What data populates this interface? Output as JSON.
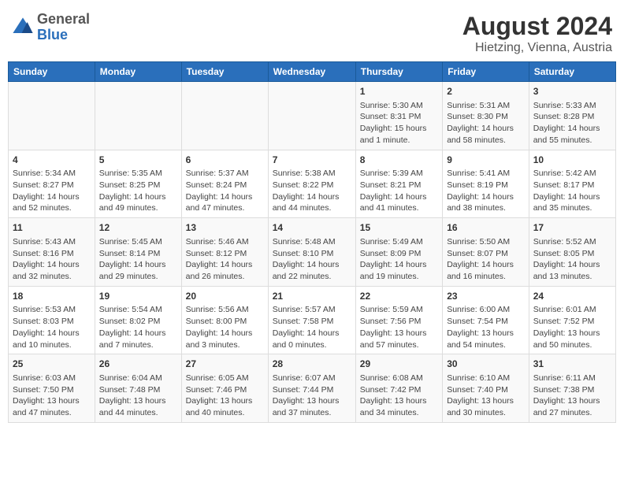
{
  "header": {
    "logo": {
      "general": "General",
      "blue": "Blue"
    },
    "title": "August 2024",
    "subtitle": "Hietzing, Vienna, Austria"
  },
  "weekdays": [
    "Sunday",
    "Monday",
    "Tuesday",
    "Wednesday",
    "Thursday",
    "Friday",
    "Saturday"
  ],
  "weeks": [
    [
      {
        "day": "",
        "info": ""
      },
      {
        "day": "",
        "info": ""
      },
      {
        "day": "",
        "info": ""
      },
      {
        "day": "",
        "info": ""
      },
      {
        "day": "1",
        "info": "Sunrise: 5:30 AM\nSunset: 8:31 PM\nDaylight: 15 hours and 1 minute."
      },
      {
        "day": "2",
        "info": "Sunrise: 5:31 AM\nSunset: 8:30 PM\nDaylight: 14 hours and 58 minutes."
      },
      {
        "day": "3",
        "info": "Sunrise: 5:33 AM\nSunset: 8:28 PM\nDaylight: 14 hours and 55 minutes."
      }
    ],
    [
      {
        "day": "4",
        "info": "Sunrise: 5:34 AM\nSunset: 8:27 PM\nDaylight: 14 hours and 52 minutes."
      },
      {
        "day": "5",
        "info": "Sunrise: 5:35 AM\nSunset: 8:25 PM\nDaylight: 14 hours and 49 minutes."
      },
      {
        "day": "6",
        "info": "Sunrise: 5:37 AM\nSunset: 8:24 PM\nDaylight: 14 hours and 47 minutes."
      },
      {
        "day": "7",
        "info": "Sunrise: 5:38 AM\nSunset: 8:22 PM\nDaylight: 14 hours and 44 minutes."
      },
      {
        "day": "8",
        "info": "Sunrise: 5:39 AM\nSunset: 8:21 PM\nDaylight: 14 hours and 41 minutes."
      },
      {
        "day": "9",
        "info": "Sunrise: 5:41 AM\nSunset: 8:19 PM\nDaylight: 14 hours and 38 minutes."
      },
      {
        "day": "10",
        "info": "Sunrise: 5:42 AM\nSunset: 8:17 PM\nDaylight: 14 hours and 35 minutes."
      }
    ],
    [
      {
        "day": "11",
        "info": "Sunrise: 5:43 AM\nSunset: 8:16 PM\nDaylight: 14 hours and 32 minutes."
      },
      {
        "day": "12",
        "info": "Sunrise: 5:45 AM\nSunset: 8:14 PM\nDaylight: 14 hours and 29 minutes."
      },
      {
        "day": "13",
        "info": "Sunrise: 5:46 AM\nSunset: 8:12 PM\nDaylight: 14 hours and 26 minutes."
      },
      {
        "day": "14",
        "info": "Sunrise: 5:48 AM\nSunset: 8:10 PM\nDaylight: 14 hours and 22 minutes."
      },
      {
        "day": "15",
        "info": "Sunrise: 5:49 AM\nSunset: 8:09 PM\nDaylight: 14 hours and 19 minutes."
      },
      {
        "day": "16",
        "info": "Sunrise: 5:50 AM\nSunset: 8:07 PM\nDaylight: 14 hours and 16 minutes."
      },
      {
        "day": "17",
        "info": "Sunrise: 5:52 AM\nSunset: 8:05 PM\nDaylight: 14 hours and 13 minutes."
      }
    ],
    [
      {
        "day": "18",
        "info": "Sunrise: 5:53 AM\nSunset: 8:03 PM\nDaylight: 14 hours and 10 minutes."
      },
      {
        "day": "19",
        "info": "Sunrise: 5:54 AM\nSunset: 8:02 PM\nDaylight: 14 hours and 7 minutes."
      },
      {
        "day": "20",
        "info": "Sunrise: 5:56 AM\nSunset: 8:00 PM\nDaylight: 14 hours and 3 minutes."
      },
      {
        "day": "21",
        "info": "Sunrise: 5:57 AM\nSunset: 7:58 PM\nDaylight: 14 hours and 0 minutes."
      },
      {
        "day": "22",
        "info": "Sunrise: 5:59 AM\nSunset: 7:56 PM\nDaylight: 13 hours and 57 minutes."
      },
      {
        "day": "23",
        "info": "Sunrise: 6:00 AM\nSunset: 7:54 PM\nDaylight: 13 hours and 54 minutes."
      },
      {
        "day": "24",
        "info": "Sunrise: 6:01 AM\nSunset: 7:52 PM\nDaylight: 13 hours and 50 minutes."
      }
    ],
    [
      {
        "day": "25",
        "info": "Sunrise: 6:03 AM\nSunset: 7:50 PM\nDaylight: 13 hours and 47 minutes."
      },
      {
        "day": "26",
        "info": "Sunrise: 6:04 AM\nSunset: 7:48 PM\nDaylight: 13 hours and 44 minutes."
      },
      {
        "day": "27",
        "info": "Sunrise: 6:05 AM\nSunset: 7:46 PM\nDaylight: 13 hours and 40 minutes."
      },
      {
        "day": "28",
        "info": "Sunrise: 6:07 AM\nSunset: 7:44 PM\nDaylight: 13 hours and 37 minutes."
      },
      {
        "day": "29",
        "info": "Sunrise: 6:08 AM\nSunset: 7:42 PM\nDaylight: 13 hours and 34 minutes."
      },
      {
        "day": "30",
        "info": "Sunrise: 6:10 AM\nSunset: 7:40 PM\nDaylight: 13 hours and 30 minutes."
      },
      {
        "day": "31",
        "info": "Sunrise: 6:11 AM\nSunset: 7:38 PM\nDaylight: 13 hours and 27 minutes."
      }
    ]
  ]
}
